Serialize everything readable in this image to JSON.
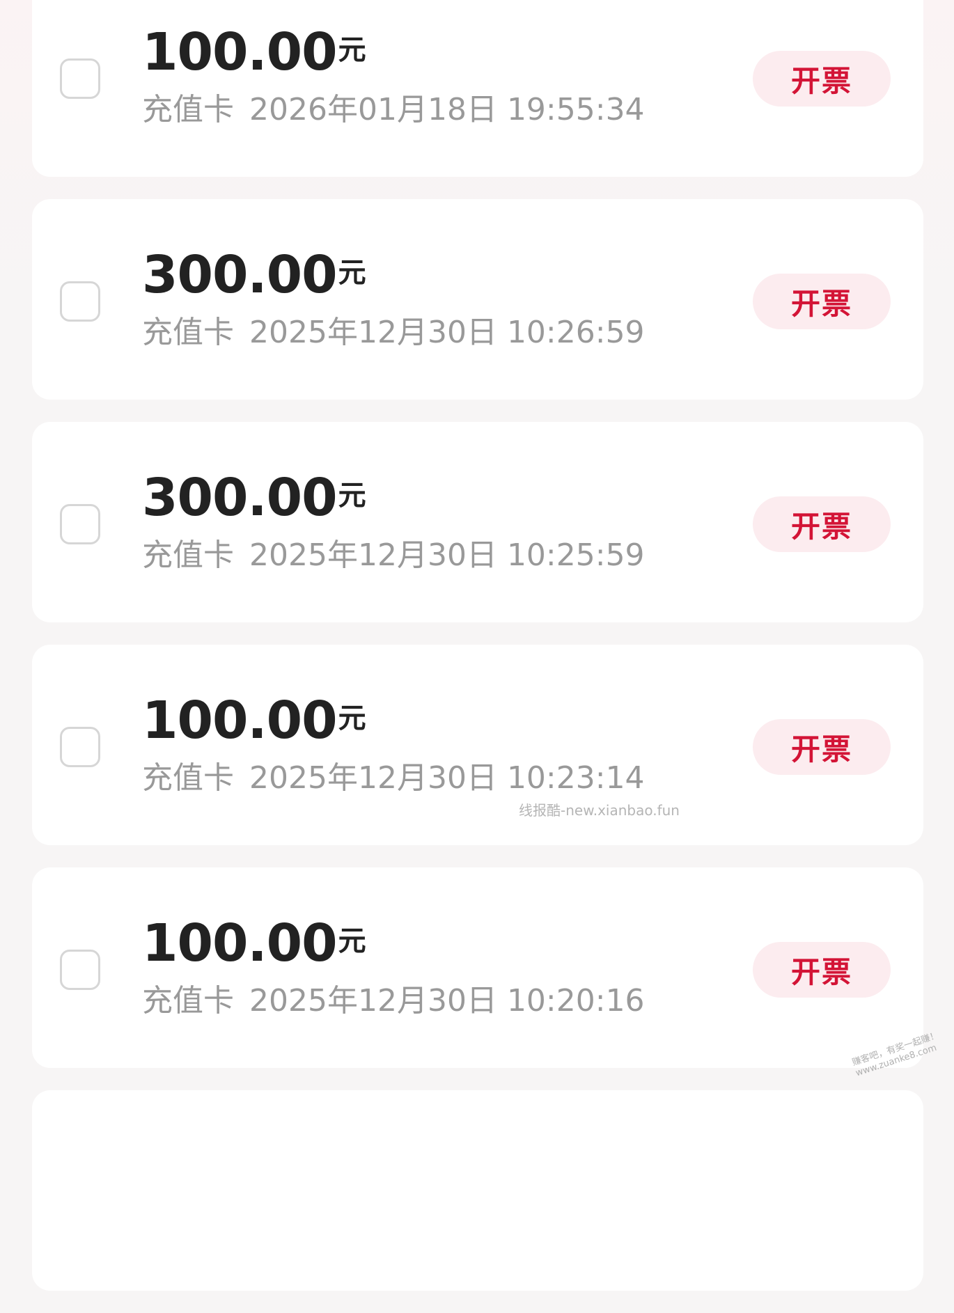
{
  "records": [
    {
      "amount": "100.00",
      "unit": "元",
      "type": "充值卡",
      "time": "2026年01月18日 19:55:34",
      "action": "开票"
    },
    {
      "amount": "300.00",
      "unit": "元",
      "type": "充值卡",
      "time": "2025年12月30日 10:26:59",
      "action": "开票"
    },
    {
      "amount": "300.00",
      "unit": "元",
      "type": "充值卡",
      "time": "2025年12月30日 10:25:59",
      "action": "开票"
    },
    {
      "amount": "100.00",
      "unit": "元",
      "type": "充值卡",
      "time": "2025年12月30日 10:23:14",
      "action": "开票"
    },
    {
      "amount": "100.00",
      "unit": "元",
      "type": "充值卡",
      "time": "2025年12月30日 10:20:16",
      "action": "开票"
    }
  ],
  "watermark": "线报酷-new.xianbao.fun",
  "corner_watermark": {
    "line1": "赚客吧，有奖一起赚！",
    "line2": "www.zuanke8.com"
  },
  "colors": {
    "accent": "#d31436",
    "button_bg": "#fcecef",
    "amount_text": "#222222",
    "meta_text": "#999999"
  }
}
